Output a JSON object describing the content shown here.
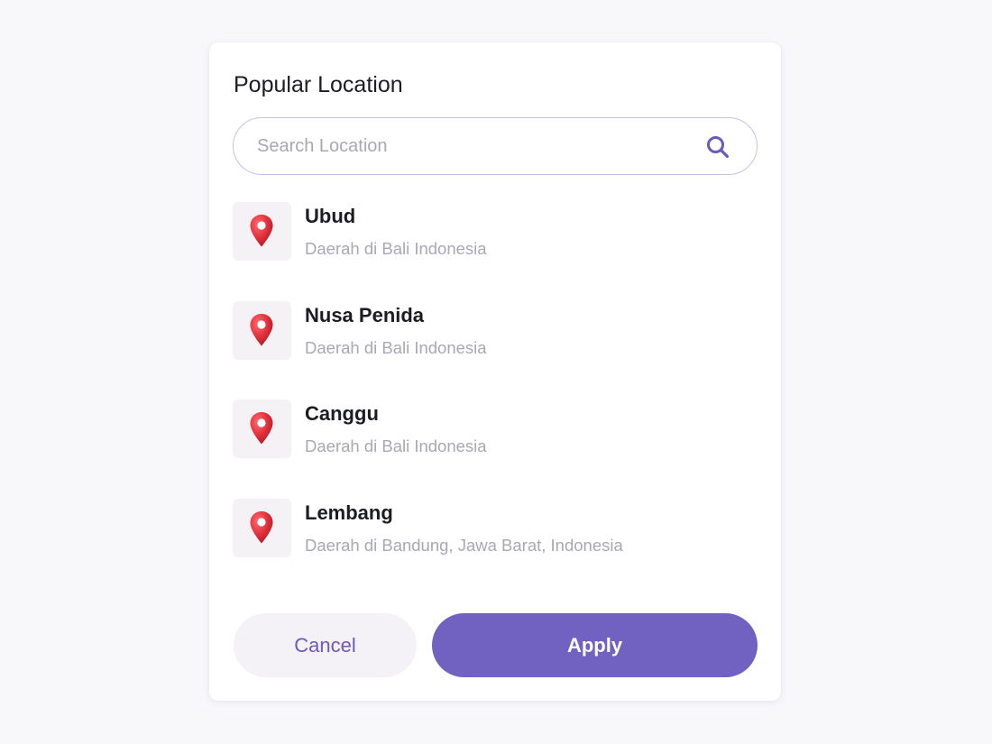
{
  "modal": {
    "title": "Popular Location"
  },
  "search": {
    "placeholder": "Search Location",
    "value": "",
    "icon": "search-icon"
  },
  "locations": [
    {
      "name": "Ubud",
      "description": "Daerah di Bali Indonesia",
      "icon": "map-pin-icon"
    },
    {
      "name": "Nusa Penida",
      "description": "Daerah di Bali Indonesia",
      "icon": "map-pin-icon"
    },
    {
      "name": "Canggu",
      "description": "Daerah di Bali Indonesia",
      "icon": "map-pin-icon"
    },
    {
      "name": "Lembang",
      "description": "Daerah di Bandung, Jawa Barat, Indonesia",
      "icon": "map-pin-icon"
    }
  ],
  "actions": {
    "cancel_label": "Cancel",
    "apply_label": "Apply"
  },
  "colors": {
    "accent": "#7161c1",
    "pin": "#e2313c",
    "background": "#f8f7fa"
  }
}
